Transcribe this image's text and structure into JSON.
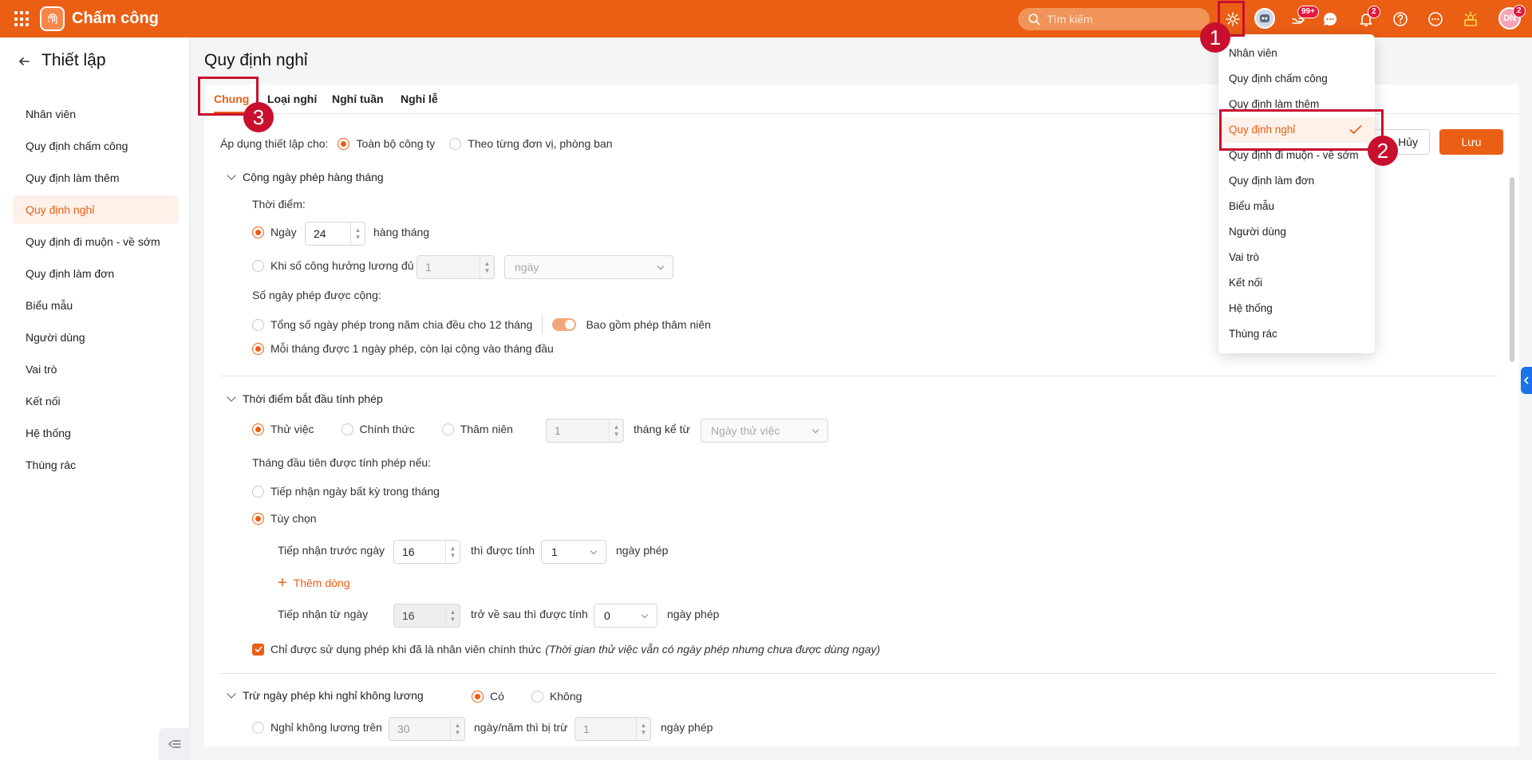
{
  "app": {
    "title": "Chấm công"
  },
  "search": {
    "placeholder": "Tìm kiếm"
  },
  "topbar": {
    "badge_tasks": "99+",
    "badge_notifications": "2",
    "badge_user": "2",
    "user_initials": "DN"
  },
  "sidebar": {
    "title": "Thiết lập",
    "items": [
      {
        "label": "Nhân viên"
      },
      {
        "label": "Quy định chấm công"
      },
      {
        "label": "Quy định làm thêm"
      },
      {
        "label": "Quy định nghỉ"
      },
      {
        "label": "Quy định đi muộn - về sớm"
      },
      {
        "label": "Quy định làm đơn"
      },
      {
        "label": "Biểu mẫu"
      },
      {
        "label": "Người dùng"
      },
      {
        "label": "Vai trò"
      },
      {
        "label": "Kết nối"
      },
      {
        "label": "Hệ thống"
      },
      {
        "label": "Thùng rác"
      }
    ]
  },
  "main": {
    "page_title": "Quy định nghỉ",
    "tabs": [
      {
        "label": "Chung"
      },
      {
        "label": "Loại nghỉ"
      },
      {
        "label": "Nghỉ tuần"
      },
      {
        "label": "Nghỉ lễ"
      }
    ],
    "cancel_label": "Hủy",
    "save_label": "Lưu",
    "apply": {
      "label": "Áp dụng thiết lập cho:",
      "opt1": "Toàn bộ công ty",
      "opt2": "Theo từng đơn vị, phòng ban"
    },
    "monthly": {
      "title": "Cộng ngày phép hàng tháng",
      "time_label": "Thời điểm:",
      "day_label": "Ngày",
      "day_value": "24",
      "monthly_suffix": "hàng tháng",
      "workdays_label": "Khi số công hưởng lương đủ",
      "workdays_value": "1",
      "workdays_unit": "ngày",
      "count_label": "Số ngày phép được cộng:",
      "opt_total": "Tổng số ngày phép trong năm chia đều cho 12 tháng",
      "seniority_toggle": "Bao gồm phép thâm niên",
      "opt_each": "Mỗi tháng được 1 ngày phép, còn lại cộng vào tháng đầu"
    },
    "start": {
      "title": "Thời điểm bắt đầu tính phép",
      "opt_probation": "Thử việc",
      "opt_official": "Chính thức",
      "opt_seniority": "Thâm niên",
      "months_value": "1",
      "months_from": "tháng kể từ",
      "from_select": "Ngày thử việc",
      "first_month_label": "Tháng đầu tiên được tính phép nếu:",
      "opt_any_day": "Tiếp nhận ngày bất kỳ trong tháng",
      "opt_custom": "Tùy chọn",
      "before_label": "Tiếp nhận trước ngày",
      "before_value": "16",
      "counted_label": "thì được tính",
      "counted_value": "1",
      "days_unit": "ngày phép",
      "add_row": "Thêm dòng",
      "from_label": "Tiếp nhận từ ngày",
      "from_value": "16",
      "after_label": "trở về sau thì được tính",
      "after_value": "0",
      "official_only": "Chỉ được sử dụng phép khi đã là nhân viên chính thức",
      "official_note": "(Thời gian thử việc vẫn có ngày phép nhưng chưa được dùng ngay)"
    },
    "unpaid": {
      "title": "Trừ ngày phép khi nghỉ không lương",
      "opt_yes": "Có",
      "opt_no": "Không",
      "over_label": "Nghỉ không lương trên",
      "over_value": "30",
      "per_year": "ngày/năm thì bị trừ",
      "deduct_value": "1",
      "days_unit": "ngày phép"
    }
  },
  "menu": {
    "items": [
      {
        "label": "Nhân viên"
      },
      {
        "label": "Quy định chấm công"
      },
      {
        "label": "Quy định làm thêm"
      },
      {
        "label": "Quy định nghỉ"
      },
      {
        "label": "Quy định đi muộn - về sớm"
      },
      {
        "label": "Quy định làm đơn"
      },
      {
        "label": "Biểu mẫu"
      },
      {
        "label": "Người dùng"
      },
      {
        "label": "Vai trò"
      },
      {
        "label": "Kết nối"
      },
      {
        "label": "Hệ thống"
      },
      {
        "label": "Thùng rác"
      }
    ]
  },
  "annotations": {
    "n1": "1",
    "n2": "2",
    "n3": "3"
  },
  "colors": {
    "brand": "#ea5f14",
    "annotation": "#c8102e"
  }
}
